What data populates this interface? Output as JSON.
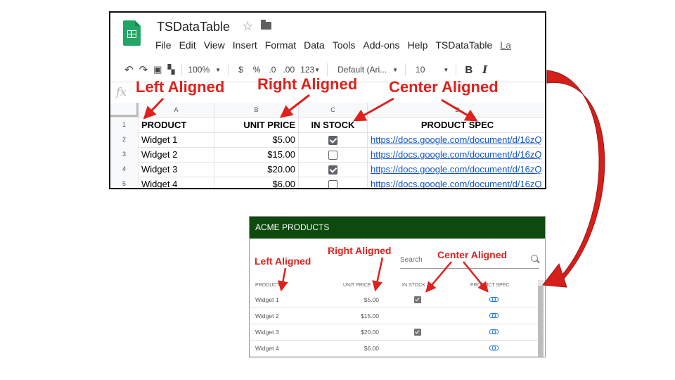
{
  "sheets": {
    "title": "TSDataTable",
    "menu": [
      "File",
      "Edit",
      "View",
      "Insert",
      "Format",
      "Data",
      "Tools",
      "Add-ons",
      "Help",
      "TSDataTable",
      "La"
    ],
    "toolbar": {
      "zoom": "100%",
      "currency": "$",
      "percent": "%",
      "dec_less": ".0",
      "dec_more": ".00",
      "format": "123",
      "font": "Default (Ari...",
      "font_size": "10",
      "bold": "B",
      "italic": "I"
    },
    "fx": "fx",
    "column_letters": [
      "A",
      "B",
      "C",
      "D"
    ],
    "row_numbers": [
      "1",
      "2",
      "3",
      "4",
      "5"
    ],
    "headers": [
      "PRODUCT",
      "UNIT PRICE",
      "IN STOCK",
      "PRODUCT SPEC"
    ],
    "rows": [
      {
        "product": "Widget 1",
        "price": "$5.00",
        "in_stock": true,
        "spec": "https://docs.google.com/document/d/16zQ"
      },
      {
        "product": "Widget 2",
        "price": "$15.00",
        "in_stock": false,
        "spec": "https://docs.google.com/document/d/16zQ"
      },
      {
        "product": "Widget 3",
        "price": "$20.00",
        "in_stock": true,
        "spec": "https://docs.google.com/document/d/16zQ"
      },
      {
        "product": "Widget 4",
        "price": "$6.00",
        "in_stock": false,
        "spec": "https://docs.google.com/document/d/16zQ"
      }
    ]
  },
  "acme": {
    "title": "ACME PRODUCTS",
    "search_placeholder": "Search",
    "headers": [
      "PRODUCT",
      "UNIT PRICE",
      "IN STOCK",
      "PRODUCT SPEC"
    ],
    "rows": [
      {
        "product": "Widget 1",
        "price": "$5.00",
        "in_stock": true
      },
      {
        "product": "Widget 2",
        "price": "$15.00",
        "in_stock": false
      },
      {
        "product": "Widget 3",
        "price": "$20.00",
        "in_stock": true
      },
      {
        "product": "Widget 4",
        "price": "$6.00",
        "in_stock": false
      }
    ]
  },
  "annotations": {
    "left": "Left Aligned",
    "right": "Right Aligned",
    "center": "Center Aligned"
  },
  "colors": {
    "annotation": "#e0201b",
    "acme_header": "#0d4a0d",
    "sheets_green": "#23a566",
    "link": "#1155cc"
  }
}
